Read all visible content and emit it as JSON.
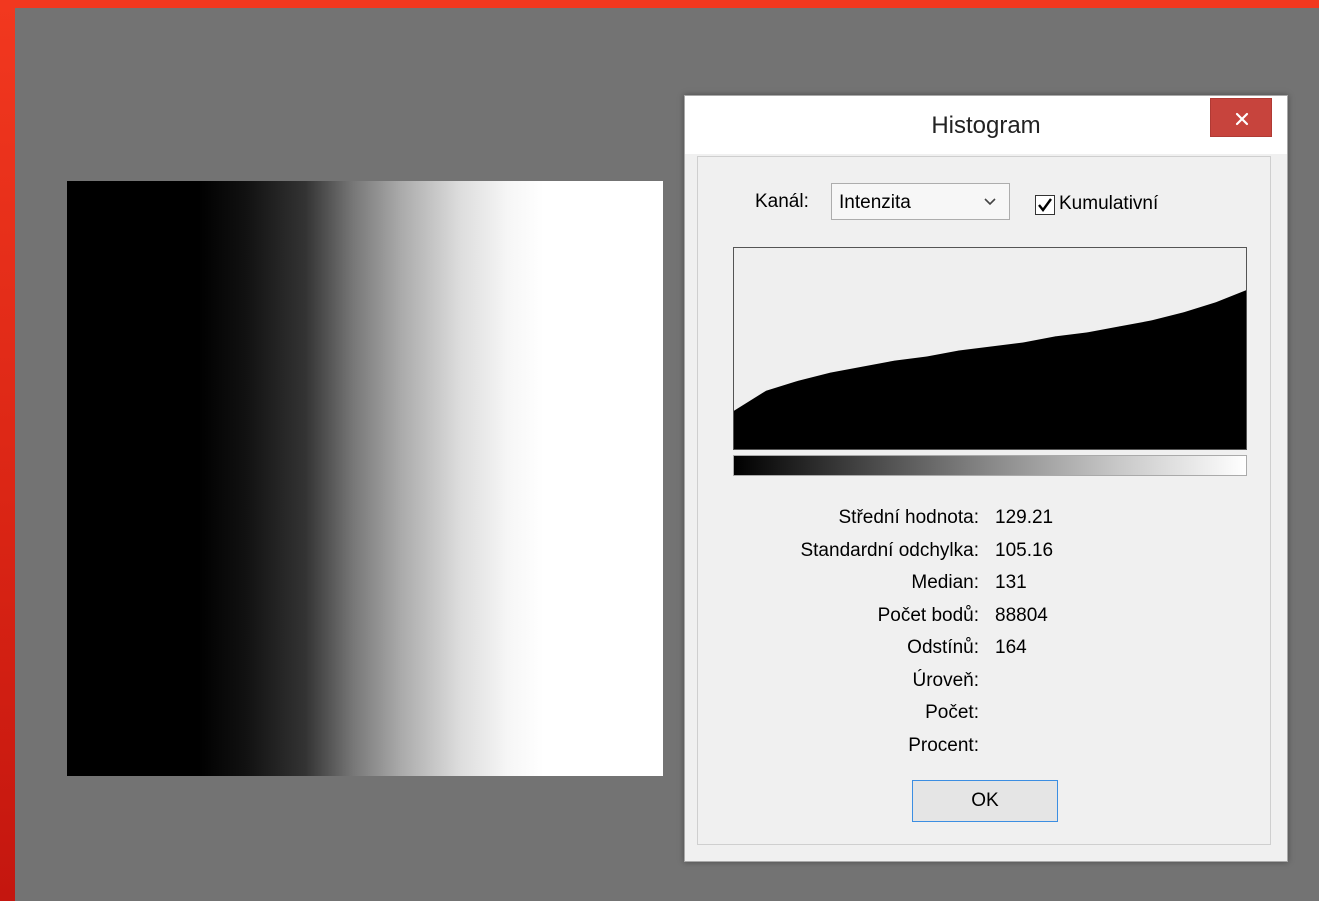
{
  "dialog": {
    "title": "Histogram",
    "channel_label": "Kanál:",
    "channel_value": "Intenzita",
    "cumulative_label": "Kumulativní",
    "cumulative_checked": true,
    "ok_label": "OK"
  },
  "stats": [
    {
      "label": "Střední hodnota:",
      "value": "129.21"
    },
    {
      "label": "Standardní odchylka:",
      "value": "105.16"
    },
    {
      "label": "Median:",
      "value": "131"
    },
    {
      "label": "Počet bodů:",
      "value": "88804"
    },
    {
      "label": "Odstínů:",
      "value": "164"
    },
    {
      "label": "Úroveň:",
      "value": ""
    },
    {
      "label": "Počet:",
      "value": ""
    },
    {
      "label": "Procent:",
      "value": ""
    }
  ],
  "chart_data": {
    "type": "area",
    "cumulative": true,
    "x": [
      0,
      16,
      32,
      48,
      64,
      80,
      96,
      112,
      128,
      144,
      160,
      176,
      192,
      208,
      224,
      240,
      255
    ],
    "values": [
      0.19,
      0.29,
      0.34,
      0.38,
      0.41,
      0.44,
      0.46,
      0.49,
      0.51,
      0.53,
      0.56,
      0.58,
      0.61,
      0.64,
      0.68,
      0.73,
      0.79
    ],
    "xlim": [
      0,
      255
    ],
    "ylim": [
      0,
      1
    ],
    "fill_color": "#000000",
    "background_color": "#efefef"
  },
  "colors": {
    "close_button": "#c7443d",
    "ok_border": "#3c8ee2",
    "window_frame": "#e8321c"
  },
  "icons": {
    "close": "close-icon",
    "dropdown": "chevron-down-icon",
    "check": "checkmark-icon"
  }
}
